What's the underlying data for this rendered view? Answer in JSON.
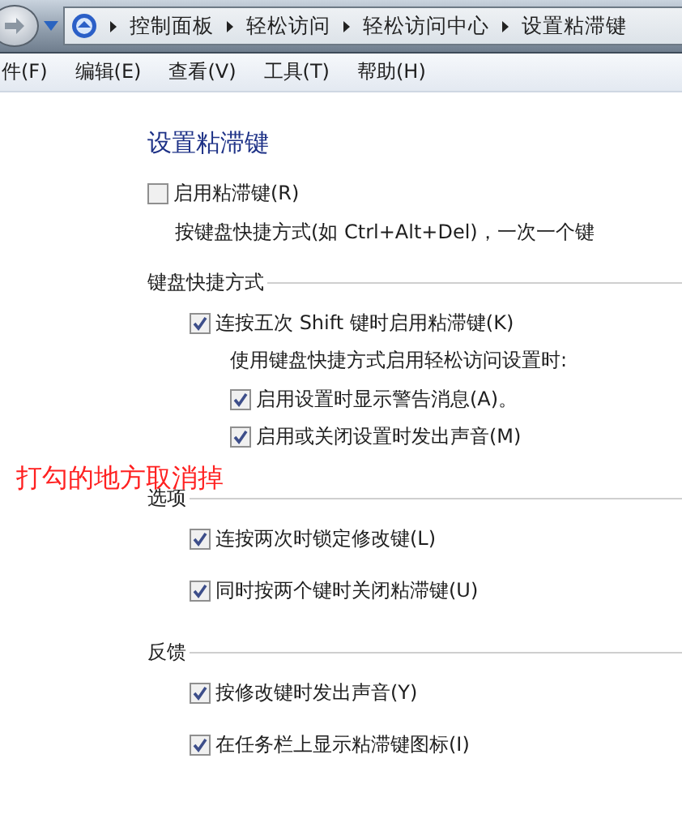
{
  "address_bar": {
    "breadcrumbs": [
      "控制面板",
      "轻松访问",
      "轻松访问中心",
      "设置粘滞键"
    ]
  },
  "menu_bar": {
    "items": [
      "件(F)",
      "编辑(E)",
      "查看(V)",
      "工具(T)",
      "帮助(H)"
    ]
  },
  "page": {
    "title": "设置粘滞键",
    "main_option": {
      "label": "启用粘滞键(R)",
      "checked": false
    },
    "description": "按键盘快捷方式(如 Ctrl+Alt+Del)，一次一个键",
    "sections": [
      {
        "heading": "键盘快捷方式",
        "items": [
          {
            "kind": "checkbox",
            "label": "连按五次 Shift 键时启用粘滞键(K)",
            "checked": true,
            "children": [
              {
                "kind": "text",
                "label": "使用键盘快捷方式启用轻松访问设置时:"
              },
              {
                "kind": "checkbox",
                "label": "启用设置时显示警告消息(A)。",
                "checked": true
              },
              {
                "kind": "checkbox",
                "label": "启用或关闭设置时发出声音(M)",
                "checked": true
              }
            ]
          }
        ]
      },
      {
        "heading": "选项",
        "items": [
          {
            "kind": "checkbox",
            "label": "连按两次时锁定修改键(L)",
            "checked": true
          },
          {
            "kind": "checkbox",
            "label": "同时按两个键时关闭粘滞键(U)",
            "checked": true
          }
        ]
      },
      {
        "heading": "反馈",
        "items": [
          {
            "kind": "checkbox",
            "label": "按修改键时发出声音(Y)",
            "checked": true
          },
          {
            "kind": "checkbox",
            "label": "在任务栏上显示粘滞键图标(I)",
            "checked": true
          }
        ]
      }
    ]
  },
  "annotation": {
    "text": "打勾的地方取消掉"
  }
}
